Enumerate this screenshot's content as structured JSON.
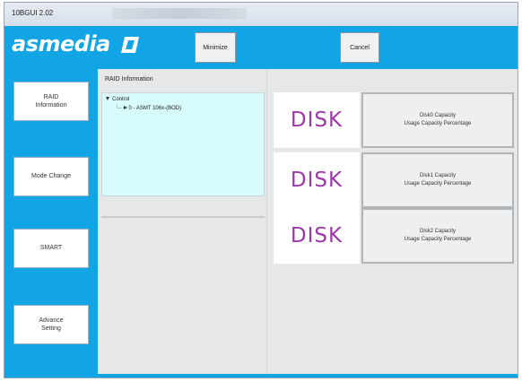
{
  "window": {
    "title": "10BGUI 2.02"
  },
  "logo": {
    "text": "asmedia"
  },
  "toolbar": {
    "minimize_label": "Minimize",
    "cancel_label": "Cancel"
  },
  "sidebar": {
    "items": [
      {
        "label": "RAID\nInformation"
      },
      {
        "label": "Mode Change"
      },
      {
        "label": "SMART"
      },
      {
        "label": "Advance\nSetting"
      }
    ]
  },
  "main": {
    "raid_information_label": "RAID Information",
    "tree": {
      "root": "Control",
      "child": "0 - ASMT 106x-(BOD)"
    },
    "disks": [
      {
        "word": "DISK",
        "capacity": "Disk0 Capacity",
        "usage": "Usage Capacity Percentage"
      },
      {
        "word": "DISK",
        "capacity": "Disk1 Capacity",
        "usage": "Usage Capacity Percentage"
      },
      {
        "word": "DISK",
        "capacity": "Disk2 Capacity",
        "usage": "Usage Capacity Percentage"
      }
    ]
  },
  "colors": {
    "accent": "#12a5e6",
    "disk_text": "#9b3aa6",
    "tree_bg": "#d8fbfc"
  },
  "icons": {
    "tree_expand": "triangle-down-icon",
    "tree_leaf": "triangle-right-icon"
  }
}
